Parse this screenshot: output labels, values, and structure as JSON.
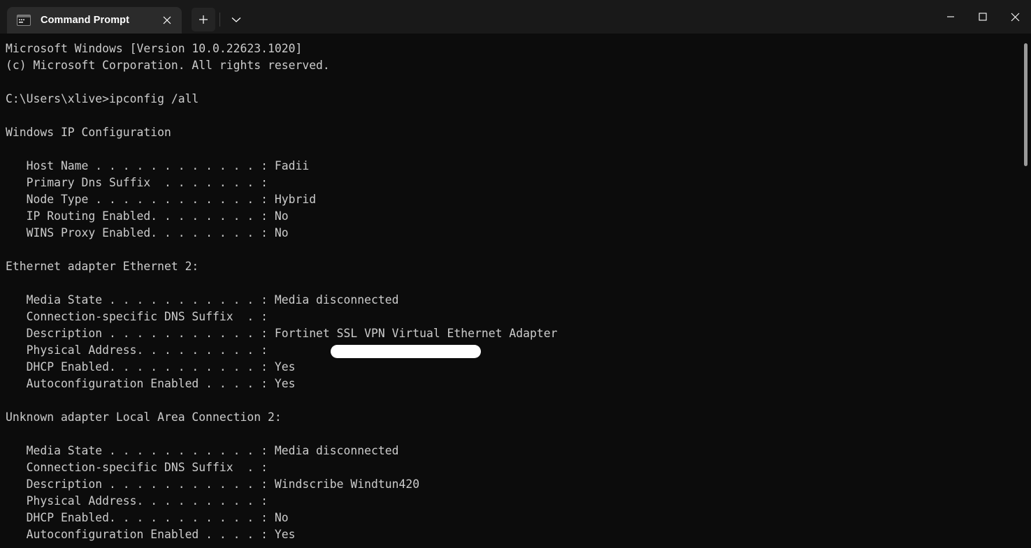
{
  "window": {
    "tab": {
      "title": "Command Prompt",
      "icon": "console-icon",
      "close_label": "✕"
    },
    "new_tab_label": "+",
    "dropdown_label": "⌄",
    "controls": {
      "minimize": "—",
      "maximize": "□",
      "close": "✕"
    },
    "colors": {
      "titlebar_bg": "#191919",
      "active_tab_bg": "#2b2b2b",
      "terminal_bg": "#0c0c0c",
      "terminal_fg": "#cccccc",
      "redaction": "#ffffff",
      "scrollbar_thumb": "#9a9a9a"
    }
  },
  "terminal": {
    "prompt_path": "C:\\Users\\xlive",
    "command": "ipconfig /all",
    "content": "Microsoft Windows [Version 10.0.22623.1020]\n(c) Microsoft Corporation. All rights reserved.\n\nC:\\Users\\xlive>ipconfig /all\n\nWindows IP Configuration\n\n   Host Name . . . . . . . . . . . . : Fadii\n   Primary Dns Suffix  . . . . . . . :\n   Node Type . . . . . . . . . . . . : Hybrid\n   IP Routing Enabled. . . . . . . . : No\n   WINS Proxy Enabled. . . . . . . . : No\n\nEthernet adapter Ethernet 2:\n\n   Media State . . . . . . . . . . . : Media disconnected\n   Connection-specific DNS Suffix  . :\n   Description . . . . . . . . . . . : Fortinet SSL VPN Virtual Ethernet Adapter\n   Physical Address. . . . . . . . . :\n   DHCP Enabled. . . . . . . . . . . : Yes\n   Autoconfiguration Enabled . . . . : Yes\n\nUnknown adapter Local Area Connection 2:\n\n   Media State . . . . . . . . . . . : Media disconnected\n   Connection-specific DNS Suffix  . :\n   Description . . . . . . . . . . . : Windscribe Windtun420\n   Physical Address. . . . . . . . . :\n   DHCP Enabled. . . . . . . . . . . : No\n   Autoconfiguration Enabled . . . . : Yes",
    "header_lines": [
      "Microsoft Windows [Version 10.0.22623.1020]",
      "(c) Microsoft Corporation. All rights reserved."
    ],
    "sections": [
      {
        "title": "Windows IP Configuration",
        "rows": [
          {
            "label": "Host Name",
            "value": "Fadii"
          },
          {
            "label": "Primary Dns Suffix",
            "value": ""
          },
          {
            "label": "Node Type",
            "value": "Hybrid"
          },
          {
            "label": "IP Routing Enabled",
            "value": "No"
          },
          {
            "label": "WINS Proxy Enabled",
            "value": "No"
          }
        ]
      },
      {
        "title": "Ethernet adapter Ethernet 2:",
        "rows": [
          {
            "label": "Media State",
            "value": "Media disconnected"
          },
          {
            "label": "Connection-specific DNS Suffix",
            "value": ""
          },
          {
            "label": "Description",
            "value": "Fortinet SSL VPN Virtual Ethernet Adapter"
          },
          {
            "label": "Physical Address",
            "value": "",
            "redacted": true
          },
          {
            "label": "DHCP Enabled",
            "value": "Yes"
          },
          {
            "label": "Autoconfiguration Enabled",
            "value": "Yes"
          }
        ]
      },
      {
        "title": "Unknown adapter Local Area Connection 2:",
        "rows": [
          {
            "label": "Media State",
            "value": "Media disconnected"
          },
          {
            "label": "Connection-specific DNS Suffix",
            "value": ""
          },
          {
            "label": "Description",
            "value": "Windscribe Windtun420"
          },
          {
            "label": "Physical Address",
            "value": ""
          },
          {
            "label": "DHCP Enabled",
            "value": "No"
          },
          {
            "label": "Autoconfiguration Enabled",
            "value": "Yes"
          }
        ]
      }
    ]
  }
}
